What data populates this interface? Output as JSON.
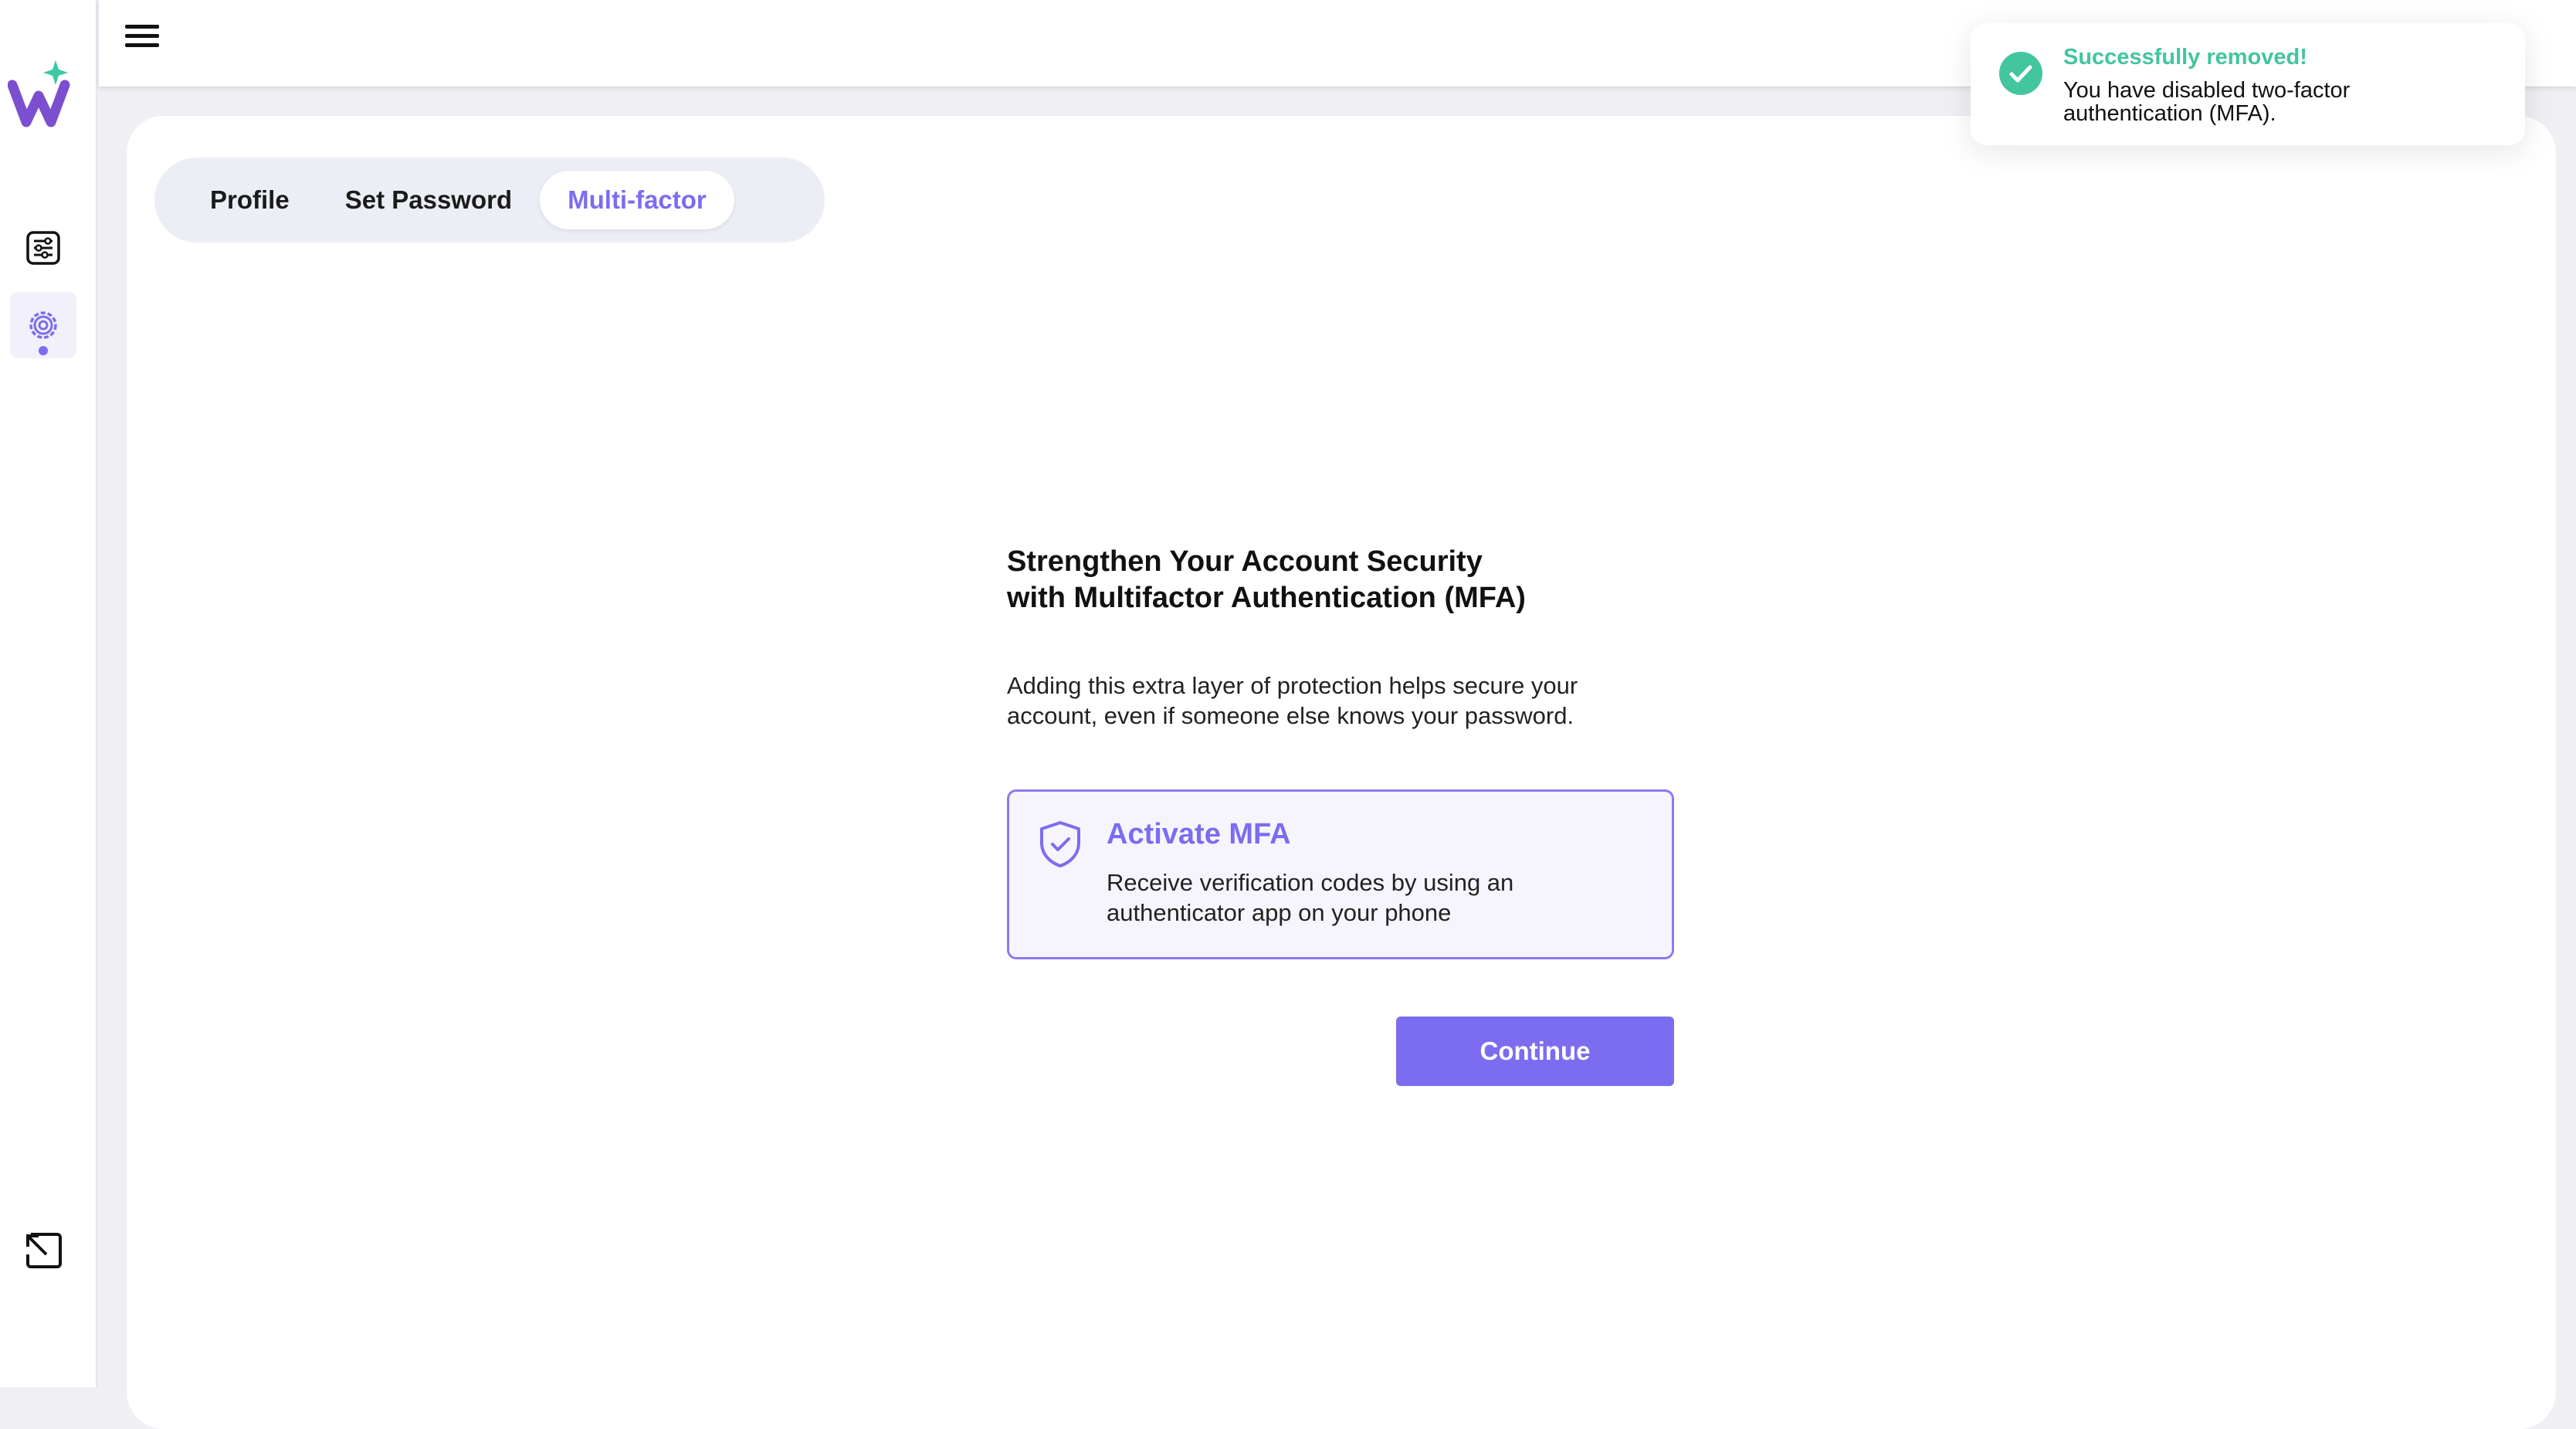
{
  "app": {
    "brand_color": "#7c6cf0",
    "success_color": "#43c59e"
  },
  "sidebar": {
    "logo": "w-sparkle-logo",
    "items": [
      {
        "icon": "sliders-list-icon",
        "active": false
      },
      {
        "icon": "gear-icon",
        "active": true
      }
    ],
    "footer_icon": "logout-arrow-icon"
  },
  "topbar": {
    "menu_icon": "hamburger-icon"
  },
  "tabs": [
    {
      "label": "Profile",
      "active": false
    },
    {
      "label": "Set Password",
      "active": false
    },
    {
      "label": "Multi-factor",
      "active": true
    }
  ],
  "main": {
    "headline_line1": "Strengthen Your Account Security",
    "headline_line2": "with Multifactor Authentication (MFA)",
    "description_line1": "Adding this extra layer of protection helps secure your",
    "description_line2": "account, even if someone else knows your password.",
    "mfa_option": {
      "icon": "shield-check-icon",
      "title": "Activate MFA",
      "desc_line1": "Receive verification codes by using an",
      "desc_line2": "authenticator app on your phone"
    },
    "continue_label": "Continue"
  },
  "toast": {
    "icon": "check-circle-icon",
    "title": "Successfully removed!",
    "message_line1": "You have disabled two-factor",
    "message_line2": "authentication (MFA)."
  }
}
